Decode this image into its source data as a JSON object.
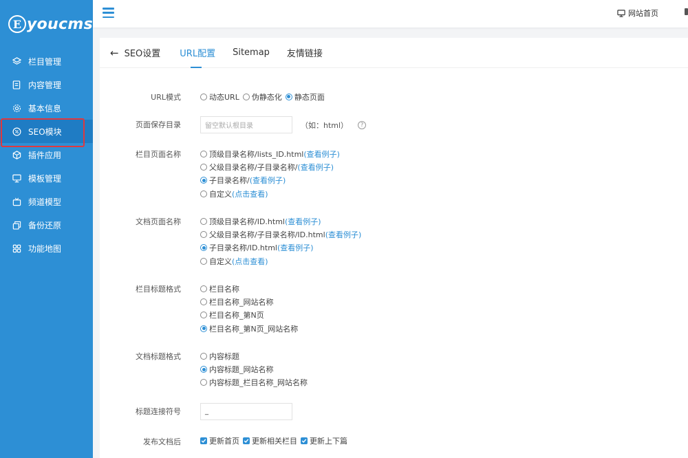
{
  "sidebar": {
    "logo_letter": "E",
    "logo_text": "youcms",
    "items": [
      {
        "label": "栏目管理",
        "icon": "layers-icon"
      },
      {
        "label": "内容管理",
        "icon": "document-icon"
      },
      {
        "label": "基本信息",
        "icon": "gear-icon"
      },
      {
        "label": "SEO模块",
        "icon": "seo-icon",
        "active": true
      },
      {
        "label": "插件应用",
        "icon": "cube-icon"
      },
      {
        "label": "模板管理",
        "icon": "monitor-icon"
      },
      {
        "label": "频道模型",
        "icon": "tv-icon"
      },
      {
        "label": "备份还原",
        "icon": "backup-icon"
      },
      {
        "label": "功能地图",
        "icon": "grid-icon"
      }
    ]
  },
  "topbar": {
    "home_label": "网站首页"
  },
  "tabs": {
    "back_label": "SEO设置",
    "items": [
      "URL配置",
      "Sitemap",
      "友情链接"
    ],
    "active_index": 0
  },
  "form": {
    "url_mode": {
      "label": "URL模式",
      "options": [
        "动态URL",
        "伪静态化",
        "静态页面"
      ],
      "selected": 2
    },
    "save_dir": {
      "label": "页面保存目录",
      "placeholder": "留空默认根目录",
      "hint": "（如：html）"
    },
    "column_page_name": {
      "label": "栏目页面名称",
      "options": [
        {
          "text": "顶级目录名称/lists_ID.html",
          "link": "(查看例子)"
        },
        {
          "text": "父级目录名称/子目录名称/",
          "link": "(查看例子)"
        },
        {
          "text": "子目录名称/",
          "link": "(查看例子)"
        },
        {
          "text": "自定义",
          "link": "(点击查看)"
        }
      ],
      "selected": 2
    },
    "doc_page_name": {
      "label": "文档页面名称",
      "options": [
        {
          "text": "顶级目录名称/ID.html",
          "link": "(查看例子)"
        },
        {
          "text": "父级目录名称/子目录名称/ID.html",
          "link": "(查看例子)"
        },
        {
          "text": "子目录名称/ID.html",
          "link": "(查看例子)"
        },
        {
          "text": "自定义",
          "link": "(点击查看)"
        }
      ],
      "selected": 2
    },
    "column_title_format": {
      "label": "栏目标题格式",
      "options": [
        "栏目名称",
        "栏目名称_网站名称",
        "栏目名称_第N页",
        "栏目名称_第N页_网站名称"
      ],
      "selected": 3
    },
    "doc_title_format": {
      "label": "文档标题格式",
      "options": [
        "内容标题",
        "内容标题_网站名称",
        "内容标题_栏目名称_网站名称"
      ],
      "selected": 1
    },
    "title_separator": {
      "label": "标题连接符号",
      "value": "_"
    },
    "after_publish": {
      "label": "发布文档后",
      "options": [
        "更新首页",
        "更新相关栏目",
        "更新上下篇"
      ]
    }
  },
  "colors": {
    "primary": "#2d8fd5",
    "highlight": "#e0383e"
  }
}
